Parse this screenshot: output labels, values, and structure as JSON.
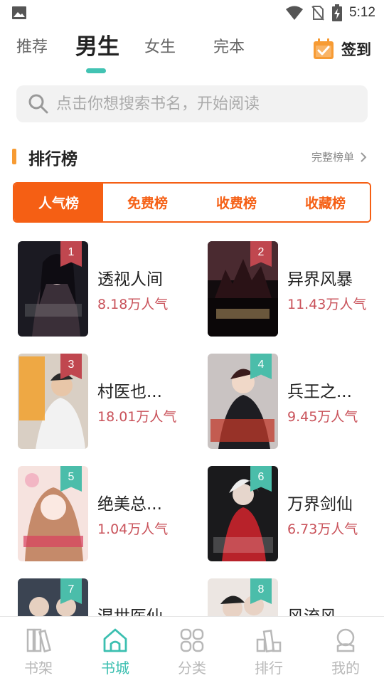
{
  "status_bar": {
    "time": "5:12"
  },
  "top_tabs": [
    {
      "label": "推荐",
      "active": false
    },
    {
      "label": "男生",
      "active": true
    },
    {
      "label": "女生",
      "active": false
    },
    {
      "label": "完本",
      "active": false
    }
  ],
  "checkin": {
    "label": "签到",
    "icon": "calendar-check-icon",
    "color": "#f79b33"
  },
  "search": {
    "placeholder": "点击你想搜索书名，开始阅读",
    "value": "",
    "icon": "search-icon"
  },
  "section": {
    "title": "排行榜",
    "more_label": "完整榜单",
    "more_icon": "chevron-right-icon"
  },
  "rank_tabs": [
    {
      "label": "人气榜",
      "active": true
    },
    {
      "label": "免费榜",
      "active": false
    },
    {
      "label": "收费榜",
      "active": false
    },
    {
      "label": "收藏榜",
      "active": false
    }
  ],
  "books": [
    {
      "rank": "1",
      "title": "透视人间",
      "popularity": "8.18万人气",
      "badge_color": "#c0474f"
    },
    {
      "rank": "2",
      "title": "异界风暴",
      "popularity": "11.43万人气",
      "badge_color": "#c0474f"
    },
    {
      "rank": "3",
      "title": "村医也...",
      "popularity": "18.01万人气",
      "badge_color": "#c0474f"
    },
    {
      "rank": "4",
      "title": "兵王之...",
      "popularity": "9.45万人气",
      "badge_color": "#4bbdaa"
    },
    {
      "rank": "5",
      "title": "绝美总...",
      "popularity": "1.04万人气",
      "badge_color": "#4bbdaa"
    },
    {
      "rank": "6",
      "title": "万界剑仙",
      "popularity": "6.73万人气",
      "badge_color": "#4bbdaa"
    },
    {
      "rank": "7",
      "title": "混世医仙",
      "popularity": "",
      "badge_color": "#4bbdaa"
    },
    {
      "rank": "8",
      "title": "风流风...",
      "popularity": "",
      "badge_color": "#4bbdaa"
    }
  ],
  "bottom_nav": [
    {
      "label": "书架",
      "icon": "bookshelf-icon",
      "active": false
    },
    {
      "label": "书城",
      "icon": "home-icon",
      "active": true
    },
    {
      "label": "分类",
      "icon": "category-grid-icon",
      "active": false
    },
    {
      "label": "排行",
      "icon": "ranking-podium-icon",
      "active": false
    },
    {
      "label": "我的",
      "icon": "profile-icon",
      "active": false
    }
  ],
  "colors": {
    "accent": "#42c3b3",
    "orange": "#f55f14",
    "popularity": "#c9525a"
  }
}
